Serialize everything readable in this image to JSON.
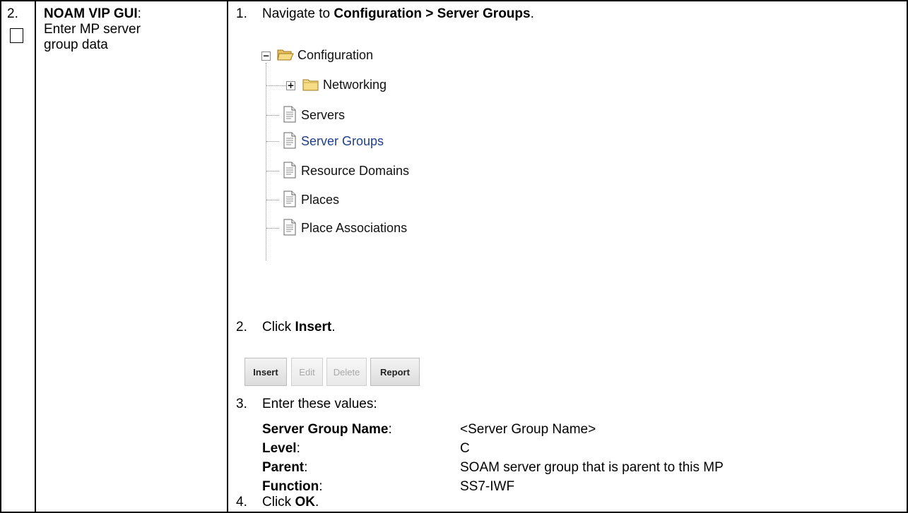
{
  "row": {
    "step_number": "2.",
    "title_bold": "NOAM VIP GUI",
    "title_rest": ":",
    "desc_line1": "Enter MP server",
    "desc_line2": "group data"
  },
  "steps": [
    {
      "num": "1.",
      "pre": "Navigate to ",
      "bold": "Configuration > Server Groups",
      "post": "."
    },
    {
      "num": "2.",
      "pre": "Click ",
      "bold": "Insert",
      "post": "."
    },
    {
      "num": "3.",
      "pre": "Enter these values:",
      "bold": "",
      "post": ""
    },
    {
      "num": "4.",
      "pre": "Click ",
      "bold": "OK",
      "post": "."
    }
  ],
  "tree": {
    "root": "Configuration",
    "items": [
      "Networking",
      "Servers",
      "Server Groups",
      "Resource Domains",
      "Places",
      "Place Associations"
    ]
  },
  "buttons": [
    "Insert",
    "Edit",
    "Delete",
    "Report"
  ],
  "fields": [
    {
      "label": "Server Group Name",
      "value": "<Server Group Name>"
    },
    {
      "label": "Level",
      "value": "C"
    },
    {
      "label": "Parent",
      "value": "SOAM server group that is parent to this MP"
    },
    {
      "label": "Function",
      "value": "SS7-IWF"
    }
  ],
  "colon": ":"
}
